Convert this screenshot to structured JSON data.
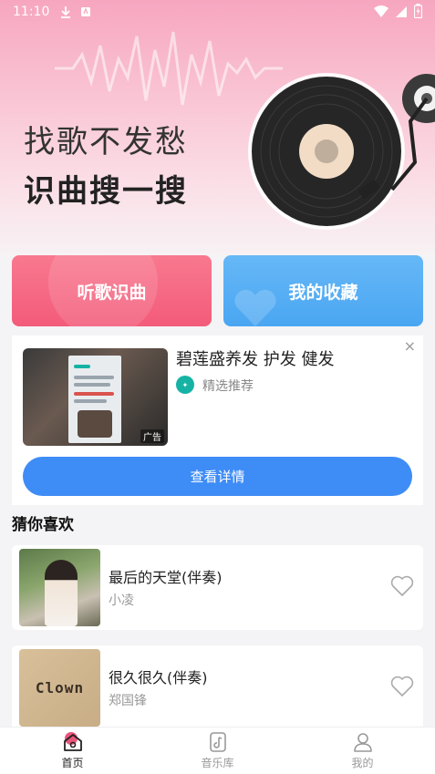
{
  "status_bar": {
    "time": "11:10"
  },
  "hero": {
    "slogan_line1": "找歌不发愁",
    "slogan_line2": "识曲搜一搜"
  },
  "actions": {
    "listen_label": "听歌识曲",
    "favorites_label": "我的收藏"
  },
  "ad": {
    "title": "碧莲盛养发 护发 健发",
    "source": "精选推荐",
    "badge": "广告",
    "cta": "查看详情",
    "close": "×"
  },
  "recommend": {
    "section_title": "猜你喜欢",
    "songs": [
      {
        "title": "最后的天堂(伴奏)",
        "artist": "小凌"
      },
      {
        "title": "很久很久(伴奏)",
        "artist": "郑国锋",
        "cover_text": "Clown"
      }
    ]
  },
  "nav": {
    "home": "首页",
    "library": "音乐库",
    "mine": "我的"
  },
  "colors": {
    "hero_pink": "#f7a6c0",
    "listen_button": "#f35b7a",
    "favorites_button": "#4aa6f2",
    "cta_blue": "#3e8cf6",
    "nav_active": "#e9557a"
  },
  "icons": {
    "status": [
      "download-icon",
      "notification-icon",
      "wifi-icon",
      "signal-icon",
      "battery-icon"
    ],
    "song_action": "heart-outline-icon",
    "nav": [
      "home-icon",
      "music-library-icon",
      "user-icon"
    ]
  }
}
